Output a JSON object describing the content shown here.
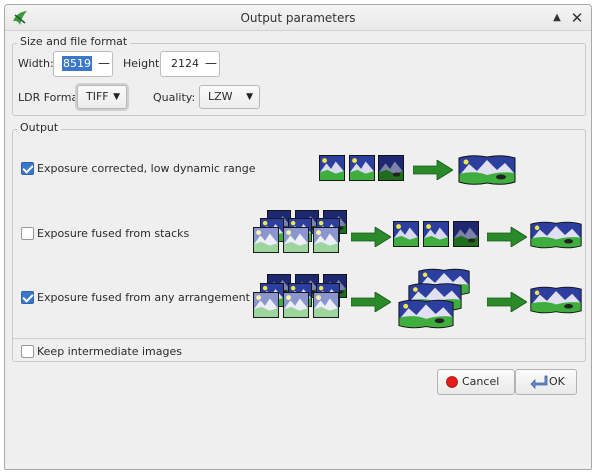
{
  "window": {
    "title": "Output parameters"
  },
  "size_group": {
    "title": "Size and file format",
    "width_label": "Width:",
    "width_value": "8519",
    "height_label": "Height:",
    "height_value": "2124",
    "ldr_label": "LDR Format:",
    "ldr_value": "TIFF",
    "quality_label": "Quality:",
    "quality_value": "LZW"
  },
  "output_group": {
    "title": "Output",
    "options": [
      {
        "label": "Exposure corrected, low dynamic range",
        "checked": true
      },
      {
        "label": "Exposure fused from stacks",
        "checked": false
      },
      {
        "label": "Exposure fused from any arrangement",
        "checked": true
      }
    ],
    "keep_intermediate": {
      "label": "Keep intermediate images",
      "checked": false
    }
  },
  "buttons": {
    "cancel": "Cancel",
    "ok": "OK"
  },
  "icons": {
    "app": "hugin-app-icon",
    "minimize": "chevron-up-icon",
    "close": "close-icon",
    "cancel": "red-circle-icon",
    "ok": "enter-arrow-icon"
  },
  "colors": {
    "accent": "#3b78c9",
    "arrow": "#2a8a2a",
    "sky": "#2c3e9e",
    "grass": "#3fae3f"
  }
}
